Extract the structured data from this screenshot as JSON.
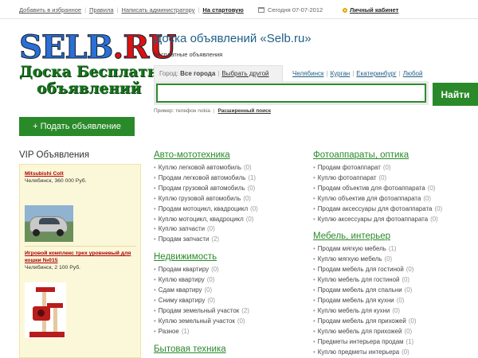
{
  "topbar": {
    "favorites": "Добавить в избранное",
    "rules": "Правила",
    "write_admin": "Написать администратору",
    "start_page": "На стартовую",
    "date": "Сегодня 07-07-2012",
    "cabinet": "Личный кабинет"
  },
  "logo": {
    "line1_a": "SELB",
    "line1_b": ".RU",
    "line2": "Доска Бесплатных",
    "line3": "объявлений"
  },
  "header": {
    "title": "Доска объявлений «Selb.ru»",
    "subtitle": "Бесплатные объявления",
    "city_label": "Город:",
    "city_value": "Все города",
    "city_other": "Выбрать другой",
    "cities": [
      "Челябинск",
      "Курган",
      "Екатеринбург",
      "Любой"
    ]
  },
  "search": {
    "value": "",
    "button": "Найти",
    "example": "Пример: телефон nokia",
    "advanced": "Расширенный поиск"
  },
  "post_button": "+ Подать объявление",
  "vip": {
    "title": "VIP Объявления",
    "items": [
      {
        "title": "Mitsubishi Colt",
        "meta": "Челябинск, 360 000 Руб."
      },
      {
        "title": "Игровой комплекс трех уровневый для кошки №015",
        "meta": "Челябинск, 2 100 Руб."
      }
    ]
  },
  "categories": {
    "auto": {
      "title": "Авто-мототехника",
      "items": [
        {
          "label": "Куплю легковой автомобиль",
          "count": "(0)"
        },
        {
          "label": "Продам легковой автомобиль",
          "count": "(1)"
        },
        {
          "label": "Продам грузовой автомобиль",
          "count": "(0)"
        },
        {
          "label": "Куплю грузовой автомобиль",
          "count": "(0)"
        },
        {
          "label": "Продам мотоцикл, квадроцикл",
          "count": "(0)"
        },
        {
          "label": "Куплю мотоцикл, квадроцикл",
          "count": "(0)"
        },
        {
          "label": "Куплю запчасти",
          "count": "(0)"
        },
        {
          "label": "Продам запчасти",
          "count": "(2)"
        }
      ]
    },
    "realty": {
      "title": "Недвижимость",
      "items": [
        {
          "label": "Продам квартиру",
          "count": "(0)"
        },
        {
          "label": "Куплю квартиру",
          "count": "(0)"
        },
        {
          "label": "Сдам квартиру",
          "count": "(0)"
        },
        {
          "label": "Сниму квартиру",
          "count": "(0)"
        },
        {
          "label": "Продам земельный участок",
          "count": "(2)"
        },
        {
          "label": "Куплю земельный участок",
          "count": "(0)"
        },
        {
          "label": "Разное",
          "count": "(1)"
        }
      ]
    },
    "home_tech": {
      "title": "Бытовая техника"
    },
    "photo": {
      "title": "Фотоаппараты, оптика",
      "items": [
        {
          "label": "Продам фотоаппарат",
          "count": "(0)"
        },
        {
          "label": "Куплю фотоаппарат",
          "count": "(0)"
        },
        {
          "label": "Продам объектив для фотоаппарата",
          "count": "(0)"
        },
        {
          "label": "Куплю объектив для фотоаппарата",
          "count": "(0)"
        },
        {
          "label": "Продам аксессуары для фотоаппарата",
          "count": "(0)"
        },
        {
          "label": "Куплю аксессуары для фотоаппарата",
          "count": "(0)"
        }
      ]
    },
    "furniture": {
      "title": "Мебель, интерьер",
      "items": [
        {
          "label": "Продам мягкую мебель",
          "count": "(1)"
        },
        {
          "label": "Куплю мягкую мебель",
          "count": "(0)"
        },
        {
          "label": "Продам мебель для гостиной",
          "count": "(0)"
        },
        {
          "label": "Куплю мебель для гостиной",
          "count": "(0)"
        },
        {
          "label": "Продам мебель для спальни",
          "count": "(0)"
        },
        {
          "label": "Продам мебель для кухни",
          "count": "(0)"
        },
        {
          "label": "Куплю мебель для кухни",
          "count": "(0)"
        },
        {
          "label": "Продам мебель для прихожей",
          "count": "(0)"
        },
        {
          "label": "Куплю мебель для прихожей",
          "count": "(0)"
        },
        {
          "label": "Предметы интерьера продам",
          "count": "(1)"
        },
        {
          "label": "Куплю предметы интерьера",
          "count": "(0)"
        }
      ]
    }
  }
}
